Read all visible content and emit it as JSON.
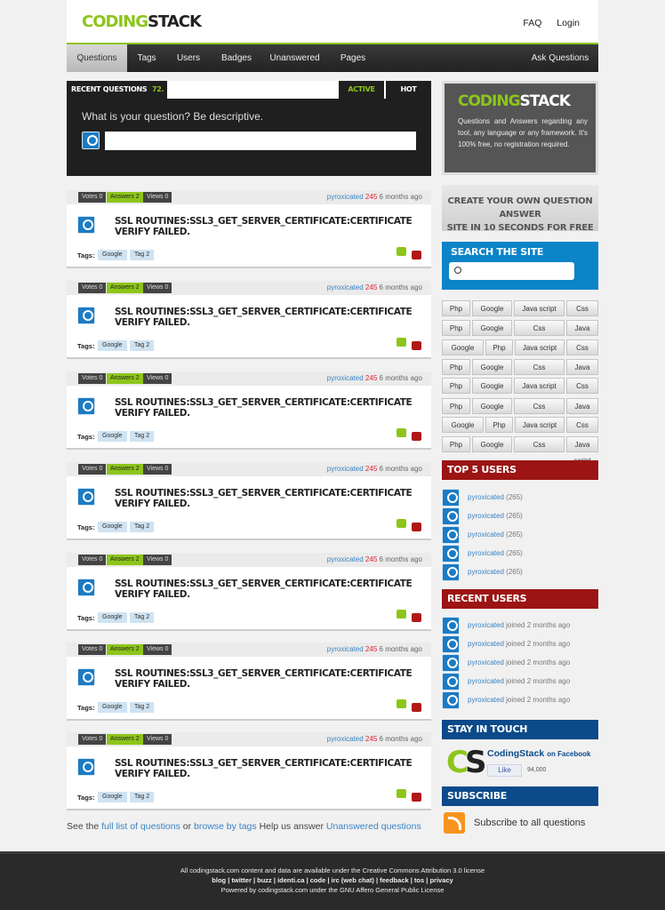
{
  "header": {
    "logo_a": "CODING",
    "logo_b": "STACK",
    "faq": "FAQ",
    "login": "Login"
  },
  "nav": {
    "items": [
      "Questions",
      "Tags",
      "Users",
      "Badges",
      "Unanswered",
      "Pages"
    ],
    "ask": "Ask Questions"
  },
  "recent": {
    "title": "RECENT QUESTIONS",
    "count": "72.",
    "tab_active": "ACTIVE",
    "tab_hot": "HOT",
    "prompt": "What is your question? Be descriptive.",
    "input_value": ""
  },
  "questions": [
    {
      "votes": "Votes 0",
      "answers": "Answers 2",
      "views": "Views 0",
      "user": "pyroxicated",
      "rep": "245",
      "time": "6 months ago",
      "title": "SSL ROUTINES:SSL3_GET_SERVER_CERTIFICATE:CERTIFICATE VERIFY FAILED.",
      "tags_label": "Tags:",
      "tags": [
        "Google",
        "Tag 2"
      ]
    },
    {
      "votes": "Votes 0",
      "answers": "Answers 2",
      "views": "Views 0",
      "user": "pyroxicated",
      "rep": "245",
      "time": "6 months ago",
      "title": "SSL ROUTINES:SSL3_GET_SERVER_CERTIFICATE:CERTIFICATE VERIFY FAILED.",
      "tags_label": "Tags:",
      "tags": [
        "Google",
        "Tag 2"
      ]
    },
    {
      "votes": "Votes 0",
      "answers": "Answers 2",
      "views": "Views 0",
      "user": "pyroxicated",
      "rep": "245",
      "time": "6 months ago",
      "title": "SSL ROUTINES:SSL3_GET_SERVER_CERTIFICATE:CERTIFICATE VERIFY FAILED.",
      "tags_label": "Tags:",
      "tags": [
        "Google",
        "Tag 2"
      ]
    },
    {
      "votes": "Votes 0",
      "answers": "Answers 2",
      "views": "Views 0",
      "user": "pyroxicated",
      "rep": "245",
      "time": "6 months ago",
      "title": "SSL ROUTINES:SSL3_GET_SERVER_CERTIFICATE:CERTIFICATE VERIFY FAILED.",
      "tags_label": "Tags:",
      "tags": [
        "Google",
        "Tag 2"
      ]
    },
    {
      "votes": "Votes 0",
      "answers": "Answers 2",
      "views": "Views 0",
      "user": "pyroxicated",
      "rep": "245",
      "time": "6 months ago",
      "title": "SSL ROUTINES:SSL3_GET_SERVER_CERTIFICATE:CERTIFICATE VERIFY FAILED.",
      "tags_label": "Tags:",
      "tags": [
        "Google",
        "Tag 2"
      ]
    },
    {
      "votes": "Votes 0",
      "answers": "Answers 2",
      "views": "Views 0",
      "user": "pyroxicated",
      "rep": "245",
      "time": "6 months ago",
      "title": "SSL ROUTINES:SSL3_GET_SERVER_CERTIFICATE:CERTIFICATE VERIFY FAILED.",
      "tags_label": "Tags:",
      "tags": [
        "Google",
        "Tag 2"
      ]
    },
    {
      "votes": "Votes 0",
      "answers": "Answers 2",
      "views": "Views 0",
      "user": "pyroxicated",
      "rep": "245",
      "time": "6 months ago",
      "title": "SSL ROUTINES:SSL3_GET_SERVER_CERTIFICATE:CERTIFICATE VERIFY FAILED.",
      "tags_label": "Tags:",
      "tags": [
        "Google",
        "Tag 2"
      ]
    }
  ],
  "bottom": {
    "see": "See the",
    "full_list": "full list of questions",
    "or": "or",
    "browse": "browse by tags",
    "help": "Help us answer",
    "unanswered": "Unanswered questions"
  },
  "sidebar": {
    "cs_logo_a": "CODING",
    "cs_logo_b": "STACK",
    "cs_desc": "Questions and Answers regarding any tool, any language or any framework. It's 100% free, no registration required.",
    "create_line1": "CREATE YOUR OWN QUESTION ANSWER",
    "create_line2": "SITE IN 10 SECONDS FOR FREE",
    "search_title": "SEARCH THE SITE",
    "search_value": "",
    "tag_rows": [
      [
        "Php",
        "Google",
        "Java script",
        "Css"
      ],
      [
        "Php",
        "Google",
        "Css",
        "Java script"
      ],
      [
        "Google",
        "Php",
        "Java script",
        "Css"
      ],
      [
        "Php",
        "Google",
        "Css",
        "Java script"
      ],
      [
        "Php",
        "Google",
        "Java script",
        "Css"
      ],
      [
        "Php",
        "Google",
        "Css",
        "Java script"
      ],
      [
        "Google",
        "Php",
        "Java script",
        "Css"
      ],
      [
        "Php",
        "Google",
        "Css",
        "Java script"
      ]
    ],
    "top_users_title": "TOP 5 USERS",
    "top_users": [
      {
        "name": "pyroxicated",
        "count": "(265)"
      },
      {
        "name": "pyroxicated",
        "count": "(265)"
      },
      {
        "name": "pyroxicated",
        "count": "(265)"
      },
      {
        "name": "pyroxicated",
        "count": "(265)"
      },
      {
        "name": "pyroxicated",
        "count": "(265)"
      }
    ],
    "recent_users_title": "RECENT USERS",
    "recent_users": [
      {
        "name": "pyroxicated",
        "joined": "joined 2 months ago"
      },
      {
        "name": "pyroxicated",
        "joined": "joined 2 months ago"
      },
      {
        "name": "pyroxicated",
        "joined": "joined 2 months ago"
      },
      {
        "name": "pyroxicated",
        "joined": "joined 2 months ago"
      },
      {
        "name": "pyroxicated",
        "joined": "joined 2 months ago"
      }
    ],
    "stay_title": "STAY IN TOUCH",
    "fb_logo_a": "C",
    "fb_logo_b": "S",
    "fb_name": "CodingStack",
    "fb_on": "on Facebook",
    "fb_like": "Like",
    "fb_count": "94,000",
    "subscribe_title": "SUBSCRIBE",
    "subscribe_text": "Subscribe to all questions"
  },
  "footer": {
    "line1": "All codingstack.com content and data are available under the Creative Commons Attribution 3.0 license",
    "line2": "blog | twitter | buzz | identi.ca | code | irc (web chat) | feedback | tos | privacy",
    "line3": "Powered by codingstack.com under the GNU Affero General Public License"
  },
  "colors": {
    "accent": "#8dc51a",
    "nav_dark": "#222222",
    "search_blue": "#0c84c8",
    "section_red": "#9c1414",
    "section_blue": "#0c4a8a",
    "link": "#3a84c4",
    "rep_red": "#dd2233"
  },
  "icons": {
    "avatar": "user-avatar-icon",
    "thumbs_up": "thumbs-up-icon",
    "thumbs_down": "thumbs-down-icon",
    "search": "search-icon",
    "rss": "rss-icon"
  }
}
